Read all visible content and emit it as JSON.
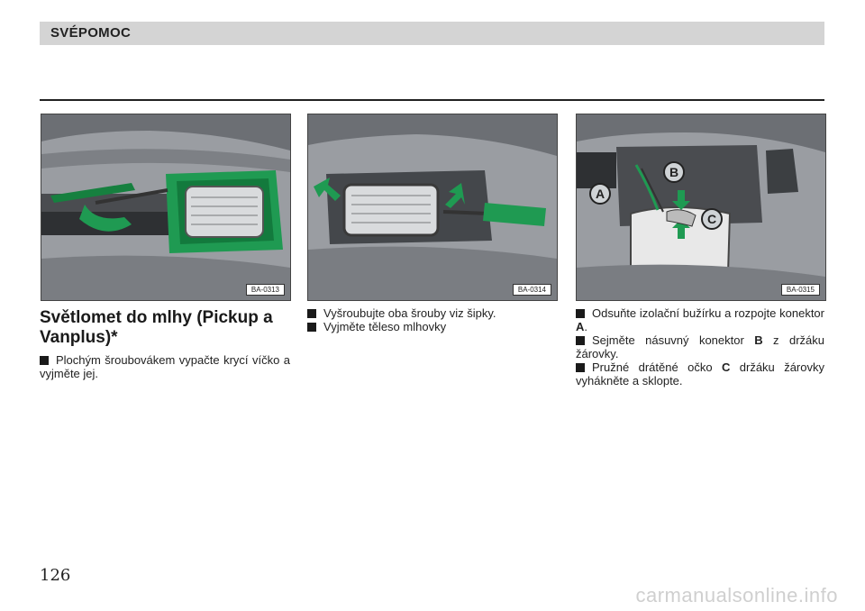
{
  "header": {
    "title": "SVÉPOMOC"
  },
  "figures": [
    {
      "code": "BA-0313"
    },
    {
      "code": "BA-0314"
    },
    {
      "code": "BA-0315",
      "labels": {
        "a": "A",
        "b": "B",
        "c": "C"
      }
    }
  ],
  "column1": {
    "title": "Světlomet do mlhy (Pickup a Vanplus)*",
    "items": [
      "Plochým šroubovákem vypačte krycí víčko a vyjměte jej."
    ]
  },
  "column2": {
    "items": [
      "Vyšroubujte oba šrouby viz šipky.",
      "Vyjměte těleso mlhovky"
    ]
  },
  "column3": {
    "item1": {
      "before": "Odsuňte izolační bužírku a rozpojte konektor ",
      "key": "A",
      "after": "."
    },
    "item2": {
      "before": "Sejměte násuvný konektor ",
      "key": "B",
      "after": " z držáku žárovky."
    },
    "item3": {
      "before": "Pružné drátěné očko ",
      "key": "C",
      "after": " držáku žárovky vyhákněte a sklopte."
    }
  },
  "page": {
    "number": "126"
  },
  "watermark": "carmanualsonline.info",
  "colors": {
    "accent_green": "#1f9a52",
    "header_gray": "#d4d4d4",
    "figure_gray": "#8e9196"
  }
}
